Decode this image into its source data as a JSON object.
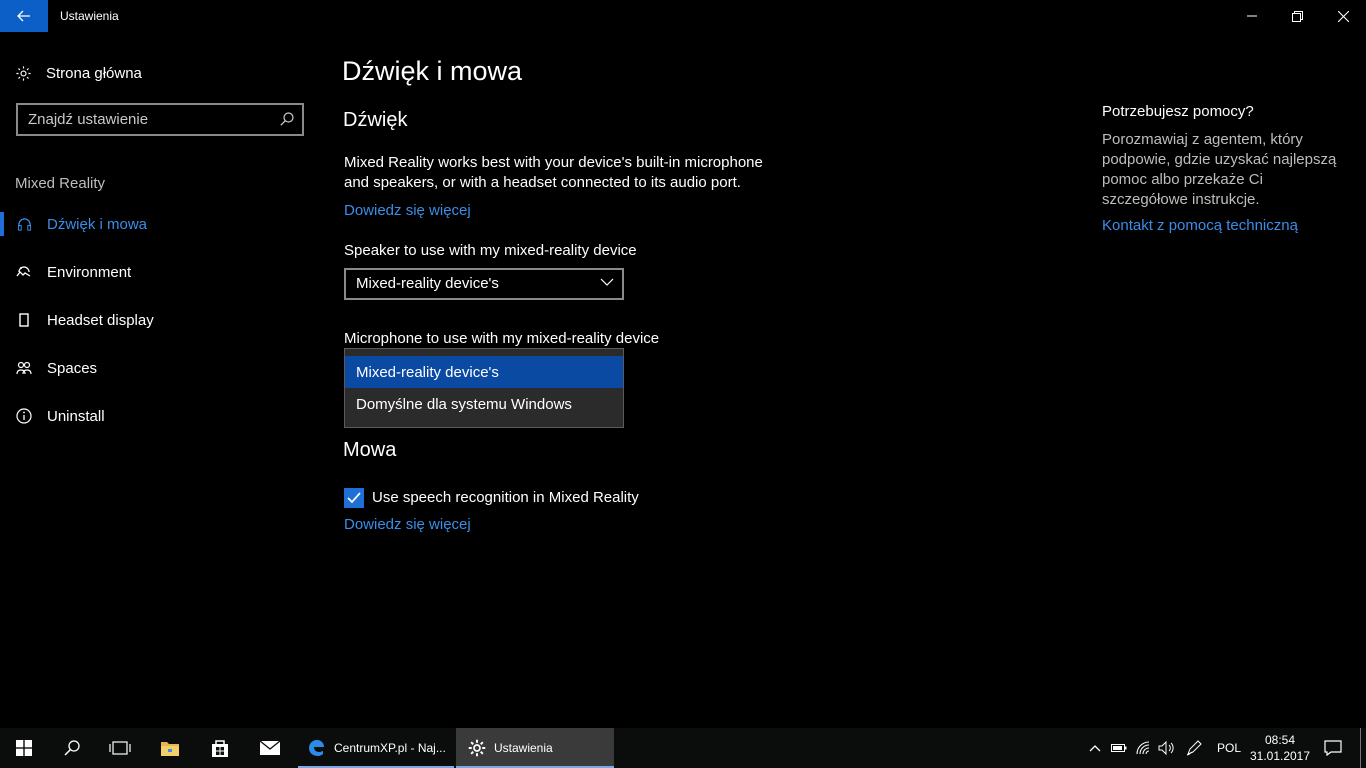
{
  "window": {
    "title": "Ustawienia"
  },
  "sidebar": {
    "home_label": "Strona główna",
    "search_placeholder": "Znajdź ustawienie",
    "section_label": "Mixed Reality",
    "items": [
      {
        "label": "Dźwięk i mowa",
        "icon": "headset-icon",
        "active": true
      },
      {
        "label": "Environment",
        "icon": "environment-icon",
        "active": false
      },
      {
        "label": "Headset display",
        "icon": "display-icon",
        "active": false
      },
      {
        "label": "Spaces",
        "icon": "spaces-icon",
        "active": false
      },
      {
        "label": "Uninstall",
        "icon": "info-icon",
        "active": false
      }
    ]
  },
  "main": {
    "title": "Dźwięk i mowa",
    "sound": {
      "heading": "Dźwięk",
      "description_line1": "Mixed Reality works best with your device's built-in microphone",
      "description_line2": "and speakers, or with a headset connected to its audio port.",
      "learn_more": "Dowiedz się więcej",
      "speaker_label": "Speaker to use with my mixed-reality device",
      "speaker_value": "Mixed-reality device's",
      "microphone_label": "Microphone to use with my mixed-reality device",
      "microphone_options": [
        {
          "label": "Mixed-reality device's",
          "selected": true
        },
        {
          "label": "Domyślne dla systemu Windows",
          "selected": false
        }
      ]
    },
    "speech": {
      "heading": "Mowa",
      "checkbox_label": "Use speech recognition in Mixed Reality",
      "checkbox_checked": true,
      "learn_more": "Dowiedz się więcej"
    }
  },
  "help": {
    "title": "Potrzebujesz pomocy?",
    "text": "Porozmawiaj z agentem, który podpowie, gdzie uzyskać najlepszą pomoc albo przekaże Ci szczegółowe instrukcje.",
    "link": "Kontakt z pomocą techniczną"
  },
  "taskbar": {
    "apps": [
      {
        "label": "CentrumXP.pl - Naj...",
        "icon": "edge-icon"
      },
      {
        "label": "Ustawienia",
        "icon": "gear-icon",
        "active": true
      }
    ],
    "language": "POL",
    "time": "08:54",
    "date": "31.01.2017"
  },
  "colors": {
    "accent": "#0b5fc6",
    "link": "#3b8de8",
    "selected_option": "#0b4aa3",
    "background": "#000000"
  }
}
